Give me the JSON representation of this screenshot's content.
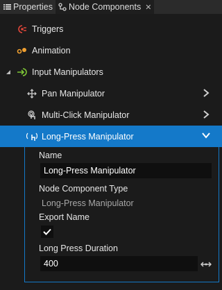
{
  "tabs": [
    {
      "label": "Properties",
      "icon": "list-icon"
    },
    {
      "label": "Node Components",
      "icon": "node-components-icon"
    }
  ],
  "tree": {
    "triggers": {
      "label": "Triggers",
      "icon": "trigger-icon"
    },
    "animation": {
      "label": "Animation",
      "icon": "animation-icon"
    },
    "input_manipulators": {
      "label": "Input Manipulators",
      "icon": "input-manipulator-icon"
    },
    "pan": {
      "label": "Pan Manipulator",
      "icon": "pan-icon"
    },
    "multi_click": {
      "label": "Multi-Click Manipulator",
      "icon": "multi-click-icon"
    },
    "long_press": {
      "label": "Long-Press Manipulator",
      "icon": "long-press-icon"
    }
  },
  "properties": {
    "name_label": "Name",
    "name_value": "Long-Press Manipulator",
    "type_label": "Node Component Type",
    "type_value": "Long-Press Manipulator",
    "export_label": "Export Name",
    "export_checked": true,
    "duration_label": "Long Press Duration",
    "duration_value": "400"
  },
  "colors": {
    "selection": "#1479c9",
    "background": "#1b1b1b",
    "field": "#0f0f0f",
    "trigger": "#e0463a",
    "animation": "#f0a030",
    "input": "#7ec636"
  }
}
